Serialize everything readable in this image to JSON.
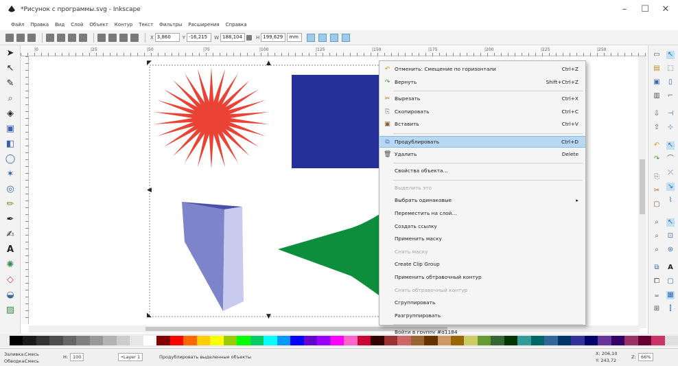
{
  "window": {
    "title": "*Рисунок с программы.svg - Inkscape",
    "minimize": "–",
    "maximize": "☐",
    "close": "✕"
  },
  "menu": [
    "Файл",
    "Правка",
    "Вид",
    "Слой",
    "Объект",
    "Контур",
    "Текст",
    "Фильтры",
    "Расширения",
    "Справка"
  ],
  "toolbar": {
    "x_label": "X",
    "x_value": "3,860",
    "y_label": "Y",
    "y_value": "-16,215",
    "w_label": "W",
    "w_value": "188,104",
    "h_label": "H",
    "h_value": "199,629",
    "unit": "mm"
  },
  "ruler_labels": [
    "|0",
    "|25",
    "|50",
    "|75",
    "|100",
    "|125",
    "|150",
    "|175",
    "|200",
    "|225",
    "|250"
  ],
  "context_menu": {
    "items": [
      {
        "icon": "undo-icon",
        "glyph": "↶",
        "color": "#c89b1e",
        "label": "Отменить: Смещение по горизонтали",
        "shortcut": "Ctrl+Z",
        "disabled": false,
        "highlight": false
      },
      {
        "icon": "redo-icon",
        "glyph": "↷",
        "color": "#3a9a2e",
        "label": "Вернуть",
        "shortcut": "Shift+Ctrl+Z",
        "disabled": false,
        "highlight": false
      },
      {
        "icon": "cut-icon",
        "glyph": "✂",
        "color": "#c06a10",
        "label": "Вырезать",
        "shortcut": "Ctrl+X",
        "disabled": false,
        "highlight": false
      },
      {
        "icon": "copy-icon",
        "glyph": "⎘",
        "color": "#777",
        "label": "Скопировать",
        "shortcut": "Ctrl+C",
        "disabled": false,
        "highlight": false
      },
      {
        "icon": "paste-icon",
        "glyph": "▣",
        "color": "#8a5a2a",
        "label": "Вставить",
        "shortcut": "Ctrl+V",
        "disabled": false,
        "highlight": false
      },
      {
        "icon": "duplicate-icon",
        "glyph": "⧉",
        "color": "#4a7ab0",
        "label": "Продублировать",
        "shortcut": "Ctrl+D",
        "disabled": false,
        "highlight": true
      },
      {
        "icon": "delete-icon",
        "glyph": "🗑",
        "color": "#444",
        "label": "Удалить",
        "shortcut": "Delete",
        "disabled": false,
        "highlight": false
      },
      {
        "icon": "",
        "glyph": "",
        "color": "",
        "label": "Свойства объекта...",
        "shortcut": "",
        "disabled": false,
        "highlight": false
      },
      {
        "icon": "",
        "glyph": "",
        "color": "",
        "label": "Выделить это",
        "shortcut": "",
        "disabled": true,
        "highlight": false
      },
      {
        "icon": "",
        "glyph": "",
        "color": "",
        "label": "Выбрать одинаковые",
        "shortcut": "▸",
        "disabled": false,
        "highlight": false
      },
      {
        "icon": "",
        "glyph": "",
        "color": "",
        "label": "Переместить на слой...",
        "shortcut": "",
        "disabled": false,
        "highlight": false
      },
      {
        "icon": "",
        "glyph": "",
        "color": "",
        "label": "Создать ссылку",
        "shortcut": "",
        "disabled": false,
        "highlight": false
      },
      {
        "icon": "",
        "glyph": "",
        "color": "",
        "label": "Применить маску",
        "shortcut": "",
        "disabled": false,
        "highlight": false
      },
      {
        "icon": "",
        "glyph": "",
        "color": "",
        "label": "Снять маску",
        "shortcut": "",
        "disabled": true,
        "highlight": false
      },
      {
        "icon": "",
        "glyph": "",
        "color": "",
        "label": "Create Clip Group",
        "shortcut": "",
        "disabled": false,
        "highlight": false
      },
      {
        "icon": "",
        "glyph": "",
        "color": "",
        "label": "Применить обтравочный контур",
        "shortcut": "",
        "disabled": false,
        "highlight": false
      },
      {
        "icon": "",
        "glyph": "",
        "color": "",
        "label": "Снять обтравочный контур",
        "shortcut": "",
        "disabled": true,
        "highlight": false
      },
      {
        "icon": "",
        "glyph": "",
        "color": "",
        "label": "Сгруппировать",
        "shortcut": "",
        "disabled": false,
        "highlight": false
      },
      {
        "icon": "",
        "glyph": "",
        "color": "",
        "label": "Разгруппировать",
        "shortcut": "",
        "disabled": false,
        "highlight": false
      },
      {
        "icon": "",
        "glyph": "",
        "color": "",
        "label": "Войти в группу #g1184",
        "shortcut": "",
        "disabled": false,
        "highlight": false
      }
    ]
  },
  "status": {
    "fill_label": "Заливка:",
    "fill_value": "Смесь",
    "stroke_label": "Обводка:",
    "stroke_value": "Смесь",
    "opacity_label": "H:",
    "opacity_value": "100",
    "layer": "•Layer 1",
    "message": "Продублировать выделенные объекты",
    "x_coord": "X: 206,10",
    "y_coord": "Y: 243,72",
    "zoom_label": "Z:",
    "zoom_value": "66%"
  },
  "colors": {
    "star": "#ea4335",
    "square": "#25309a",
    "prism_front": "#c9cbee",
    "prism_side": "#7e84c9",
    "prism_top": "#4a4fa8",
    "arrow": "#0d8e3d",
    "highlight": "#b7d8f3"
  },
  "palette": [
    "#000000",
    "#1a1a1a",
    "#333333",
    "#4d4d4d",
    "#666666",
    "#808080",
    "#999999",
    "#b3b3b3",
    "#cccccc",
    "#e6e6e6",
    "#ffffff",
    "#800000",
    "#ff0000",
    "#ff6600",
    "#ffcc00",
    "#ffff00",
    "#99cc00",
    "#00ff00",
    "#00cc66",
    "#00ffff",
    "#0099ff",
    "#0000ff",
    "#6600cc",
    "#9900ff",
    "#ff00ff",
    "#ff66cc",
    "#cc0033",
    "#330000",
    "#993333",
    "#cc6666",
    "#996633",
    "#663300",
    "#cc9966",
    "#996600",
    "#cccc66",
    "#669933",
    "#336633",
    "#003300",
    "#339999",
    "#006666",
    "#336699",
    "#003366",
    "#333399",
    "#000066",
    "#663399",
    "#330066",
    "#993366",
    "#660033",
    "#cc3366",
    "#e0e0e0"
  ]
}
